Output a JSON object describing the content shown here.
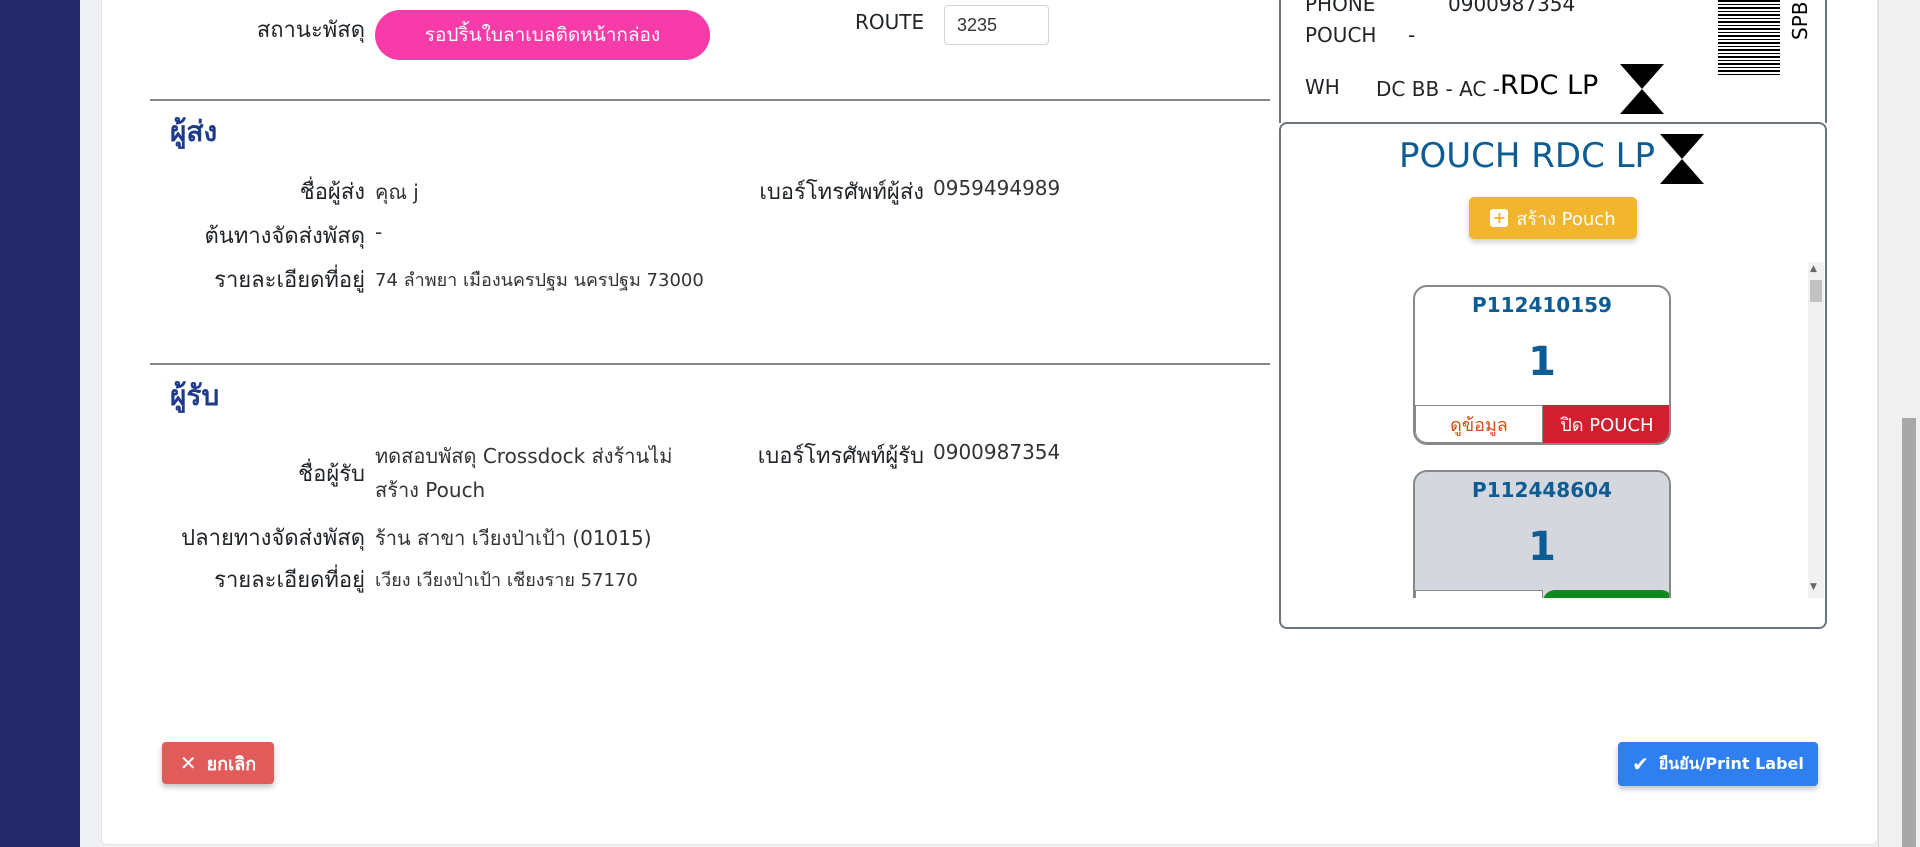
{
  "status": {
    "label": "สถานะพัสดุ",
    "value": "รอปริ้นใบลาเบลติดหน้ากล่อง",
    "color": "#f73ba8"
  },
  "route": {
    "label": "ROUTE",
    "value": "3235"
  },
  "sender": {
    "title": "ผู้ส่ง",
    "name_label": "ชื่อผู้ส่ง",
    "name": "คุณ j",
    "phone_label": "เบอร์โทรศัพท์ผู้ส่ง",
    "phone": "0959494989",
    "origin_label": "ต้นทางจัดส่งพัสดุ",
    "origin": "-",
    "address_label": "รายละเอียดที่อยู่",
    "address": "74 ลำพยา เมืองนครปฐม นครปฐม 73000"
  },
  "receiver": {
    "title": "ผู้รับ",
    "name_label": "ชื่อผู้รับ",
    "name_line1": "ทดสอบพัสดุ Crossdock ส่งร้านไม่",
    "name_line2": "สร้าง Pouch",
    "phone_label": "เบอร์โทรศัพท์ผู้รับ",
    "phone": "0900987354",
    "destination_label": "ปลายทางจัดส่งพัสดุ",
    "destination": "ร้าน สาขา เวียงป่าเป้า (01015)",
    "address_label": "รายละเอียดที่อยู่",
    "address": "เวียง เวียงป่าเป้า เชียงราย 57170"
  },
  "label_preview": {
    "phone_label": "PHONE",
    "phone": "0900987354",
    "pouch_label": "POUCH",
    "pouch_value": "-",
    "wh_label": "WH",
    "wh_prefix": "DC BB - AC -",
    "wh_code": "RDC LP",
    "side_text": "SPB"
  },
  "pouch_panel": {
    "title": "POUCH RDC LP",
    "create_button": "สร้าง Pouch",
    "cards": [
      {
        "id": "P112410159",
        "count": "1",
        "view_label": "ดูข้อมูล",
        "close_label": "ปิด POUCH",
        "bg": "#ffffff"
      },
      {
        "id": "P112448604",
        "count": "1",
        "bg": "#d4d7de"
      }
    ]
  },
  "actions": {
    "cancel": "ยกเลิก",
    "confirm": "ยืนยัน/Print Label"
  },
  "colors": {
    "sidebar": "#252a6a",
    "title_blue": "#1e3a8a",
    "pouch_blue": "#0d5c94",
    "create_button": "#f2b530",
    "close_pouch": "#d0202f",
    "cancel_button": "#e25b5b",
    "confirm_button": "#2f7ff0"
  }
}
